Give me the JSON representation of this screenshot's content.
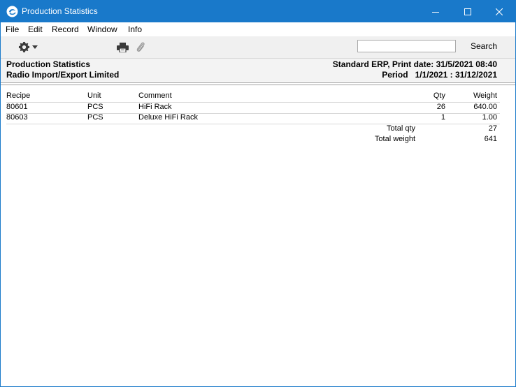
{
  "window": {
    "title": "Production Statistics"
  },
  "menu": {
    "items": [
      "File",
      "Edit",
      "Record",
      "Window",
      "Info"
    ]
  },
  "toolbar": {
    "search_value": "",
    "search_label": "Search",
    "icons": [
      "gear-icon",
      "chevron-down-icon",
      "print-icon",
      "paperclip-icon"
    ]
  },
  "report_header": {
    "title": "Production Statistics",
    "company": "Radio Import/Export Limited",
    "print_info": "Standard ERP, Print date: 31/5/2021 08:40",
    "period_label": "Period",
    "period_value": "1/1/2021 : 31/12/2021"
  },
  "table": {
    "columns": {
      "recipe": "Recipe",
      "unit": "Unit",
      "comment": "Comment",
      "qty": "Qty",
      "weight": "Weight"
    },
    "rows": [
      {
        "recipe": "80601",
        "unit": "PCS",
        "comment": "HiFi Rack",
        "qty": "26",
        "weight": "640.00"
      },
      {
        "recipe": "80603",
        "unit": "PCS",
        "comment": "Deluxe HiFi Rack",
        "qty": "1",
        "weight": "1.00"
      }
    ],
    "totals": {
      "qty_label": "Total qty",
      "qty_value": "27",
      "weight_label": "Total weight",
      "weight_value": "641"
    }
  },
  "colors": {
    "titlebar": "#1979ca",
    "toolbar_bg": "#f0f0f0",
    "header_bg": "#f3f3f3"
  }
}
